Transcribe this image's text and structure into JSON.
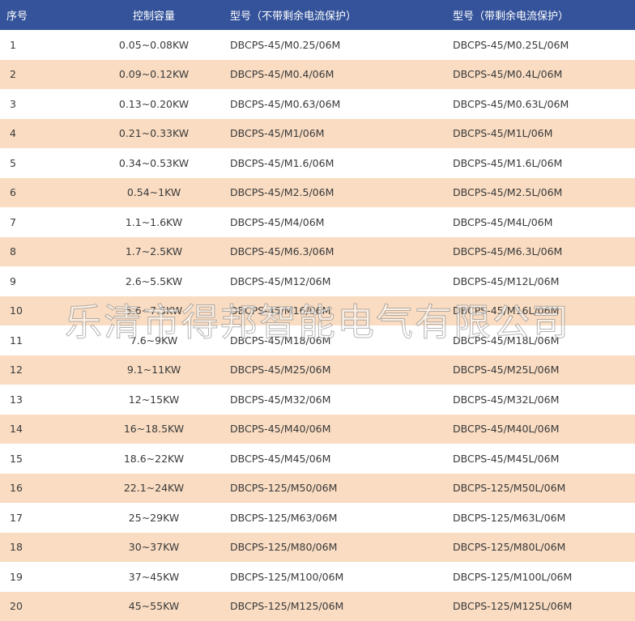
{
  "header": {
    "index": "序号",
    "capacity": "控制容量",
    "model_no_rcd": "型号（不带剩余电流保护）",
    "model_rcd": "型号（带剩余电流保护）"
  },
  "rows": [
    {
      "index": "1",
      "capacity": "0.05~0.08KW",
      "model_no_rcd": "DBCPS-45/M0.25/06M",
      "model_rcd": "DBCPS-45/M0.25L/06M"
    },
    {
      "index": "2",
      "capacity": "0.09~0.12KW",
      "model_no_rcd": "DBCPS-45/M0.4/06M",
      "model_rcd": "DBCPS-45/M0.4L/06M"
    },
    {
      "index": "3",
      "capacity": "0.13~0.20KW",
      "model_no_rcd": "DBCPS-45/M0.63/06M",
      "model_rcd": "DBCPS-45/M0.63L/06M"
    },
    {
      "index": "4",
      "capacity": "0.21~0.33KW",
      "model_no_rcd": "DBCPS-45/M1/06M",
      "model_rcd": "DBCPS-45/M1L/06M"
    },
    {
      "index": "5",
      "capacity": "0.34~0.53KW",
      "model_no_rcd": "DBCPS-45/M1.6/06M",
      "model_rcd": "DBCPS-45/M1.6L/06M"
    },
    {
      "index": "6",
      "capacity": "0.54~1KW",
      "model_no_rcd": "DBCPS-45/M2.5/06M",
      "model_rcd": "DBCPS-45/M2.5L/06M"
    },
    {
      "index": "7",
      "capacity": "1.1~1.6KW",
      "model_no_rcd": "DBCPS-45/M4/06M",
      "model_rcd": "DBCPS-45/M4L/06M"
    },
    {
      "index": "8",
      "capacity": "1.7~2.5KW",
      "model_no_rcd": "DBCPS-45/M6.3/06M",
      "model_rcd": "DBCPS-45/M6.3L/06M"
    },
    {
      "index": "9",
      "capacity": "2.6~5.5KW",
      "model_no_rcd": "DBCPS-45/M12/06M",
      "model_rcd": "DBCPS-45/M12L/06M"
    },
    {
      "index": "10",
      "capacity": "5.6~7.5KW",
      "model_no_rcd": "DBCPS-45/M16/06M",
      "model_rcd": "DBCPS-45/M16L/06M"
    },
    {
      "index": "11",
      "capacity": "7.6~9KW",
      "model_no_rcd": "DBCPS-45/M18/06M",
      "model_rcd": "DBCPS-45/M18L/06M"
    },
    {
      "index": "12",
      "capacity": "9.1~11KW",
      "model_no_rcd": "DBCPS-45/M25/06M",
      "model_rcd": "DBCPS-45/M25L/06M"
    },
    {
      "index": "13",
      "capacity": "12~15KW",
      "model_no_rcd": "DBCPS-45/M32/06M",
      "model_rcd": "DBCPS-45/M32L/06M"
    },
    {
      "index": "14",
      "capacity": "16~18.5KW",
      "model_no_rcd": "DBCPS-45/M40/06M",
      "model_rcd": "DBCPS-45/M40L/06M"
    },
    {
      "index": "15",
      "capacity": "18.6~22KW",
      "model_no_rcd": "DBCPS-45/M45/06M",
      "model_rcd": "DBCPS-45/M45L/06M"
    },
    {
      "index": "16",
      "capacity": "22.1~24KW",
      "model_no_rcd": "DBCPS-125/M50/06M",
      "model_rcd": "DBCPS-125/M50L/06M"
    },
    {
      "index": "17",
      "capacity": "25~29KW",
      "model_no_rcd": "DBCPS-125/M63/06M",
      "model_rcd": "DBCPS-125/M63L/06M"
    },
    {
      "index": "18",
      "capacity": "30~37KW",
      "model_no_rcd": "DBCPS-125/M80/06M",
      "model_rcd": "DBCPS-125/M80L/06M"
    },
    {
      "index": "19",
      "capacity": "37~45KW",
      "model_no_rcd": "DBCPS-125/M100/06M",
      "model_rcd": "DBCPS-125/M100L/06M"
    },
    {
      "index": "20",
      "capacity": "45~55KW",
      "model_no_rcd": "DBCPS-125/M125/06M",
      "model_rcd": "DBCPS-125/M125L/06M"
    }
  ],
  "watermark": "乐清市得邦智能电气有限公司",
  "colors": {
    "header_bg": "#34539a",
    "stripe_bg": "#f9dcc2"
  }
}
